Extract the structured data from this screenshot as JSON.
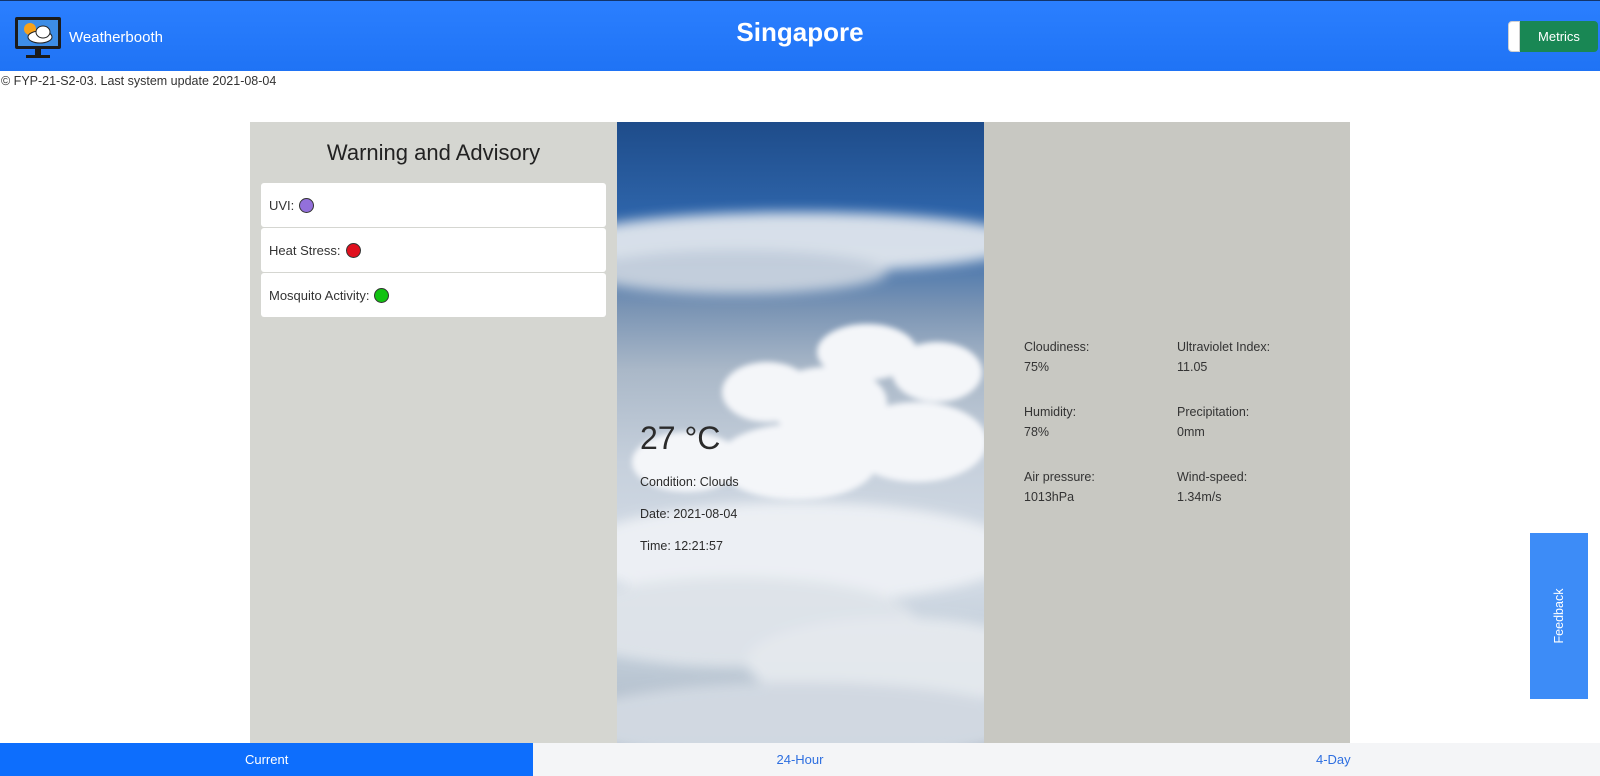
{
  "header": {
    "brand_name": "Weatherbooth",
    "logo_icon": "monitor-weather-icon",
    "city": "Singapore",
    "metrics_label": "Metrics",
    "colors": {
      "bar": "#2b7fff",
      "metrics_button": "#198754"
    }
  },
  "footer_note": "© FYP-21-S2-03. Last system update 2021-08-04",
  "advisory": {
    "title": "Warning and Advisory",
    "items": [
      {
        "label": "UVI:",
        "status_color": "#9370db"
      },
      {
        "label": "Heat Stress:",
        "status_color": "#e0101e"
      },
      {
        "label": "Mosquito Activity:",
        "status_color": "#12c212"
      }
    ]
  },
  "current": {
    "temperature": "27 °C",
    "condition": "Condition: Clouds",
    "date": "Date: 2021-08-04",
    "time": "Time: 12:21:57"
  },
  "metrics": {
    "cloudiness": {
      "label": "Cloudiness:",
      "value": "75%"
    },
    "uv_index": {
      "label": "Ultraviolet Index:",
      "value": "11.05"
    },
    "humidity": {
      "label": "Humidity:",
      "value": "78%"
    },
    "precipitation": {
      "label": "Precipitation:",
      "value": "0mm"
    },
    "air_pressure": {
      "label": "Air pressure:",
      "value": "1013hPa"
    },
    "wind_speed": {
      "label": "Wind-speed:",
      "value": "1.34m/s"
    }
  },
  "feedback_label": "Feedback",
  "tabs": [
    {
      "label": "Current",
      "active": true
    },
    {
      "label": "24-Hour",
      "active": false
    },
    {
      "label": "4-Day",
      "active": false
    }
  ]
}
